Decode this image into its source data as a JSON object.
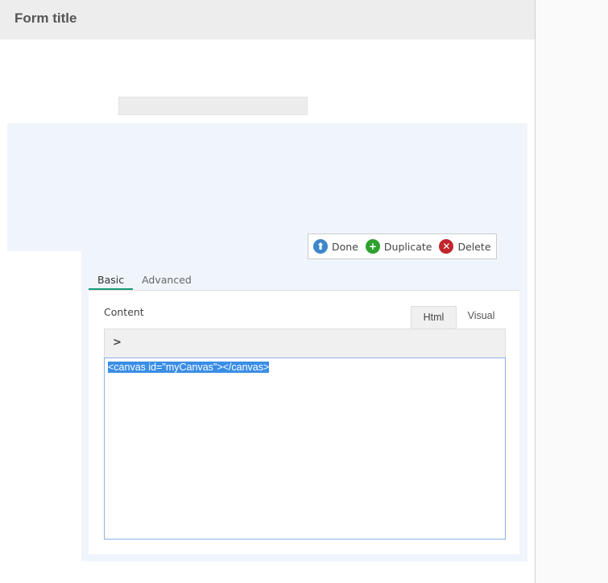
{
  "header": {
    "title": "Form title"
  },
  "toolbar": {
    "done": "Done",
    "duplicate": "Duplicate",
    "delete": "Delete"
  },
  "tabs": [
    {
      "label": "Basic"
    },
    {
      "label": "Advanced"
    }
  ],
  "content": {
    "label": "Content",
    "mode_tabs": [
      "Html",
      "Visual"
    ],
    "code": "<canvas id=\"myCanvas\"></canvas>"
  },
  "colors": {
    "accent": "#1a9a7a",
    "selection": "#3a8ee6",
    "done": "#3d87c9",
    "duplicate": "#2ea02e",
    "delete": "#c0262c"
  }
}
